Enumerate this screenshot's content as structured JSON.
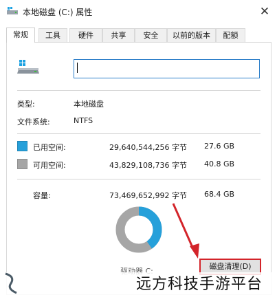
{
  "window": {
    "title": "本地磁盘 (C:) 属性",
    "close_glyph": "✕"
  },
  "tabs": [
    {
      "label": "常规",
      "active": true
    },
    {
      "label": "工具",
      "active": false
    },
    {
      "label": "硬件",
      "active": false
    },
    {
      "label": "共享",
      "active": false
    },
    {
      "label": "安全",
      "active": false
    },
    {
      "label": "以前的版本",
      "active": false
    },
    {
      "label": "配额",
      "active": false
    }
  ],
  "drive_name_input": {
    "value": "",
    "placeholder": ""
  },
  "info": {
    "type_label": "类型:",
    "type_value": "本地磁盘",
    "fs_label": "文件系统:",
    "fs_value": "NTFS"
  },
  "space": {
    "used": {
      "label": "已用空间:",
      "bytes": "29,640,544,256 字节",
      "human": "27.6 GB",
      "color": "#26a0da"
    },
    "free": {
      "label": "可用空间:",
      "bytes": "43,829,108,736 字节",
      "human": "40.8 GB",
      "color": "#a6a6a6"
    },
    "capacity": {
      "label": "容量:",
      "bytes": "73,469,652,992 字节",
      "human": "68.4 GB"
    }
  },
  "donut": {
    "used_fraction": 0.4034
  },
  "drive_label": "驱动器 C:",
  "cleanup_button": "磁盘清理(D)",
  "watermark": {
    "text": "远方科技手游平台",
    "logo": "logo-icon"
  },
  "colors": {
    "accent": "#26a0da",
    "highlight": "#d3242a",
    "free": "#a6a6a6"
  }
}
